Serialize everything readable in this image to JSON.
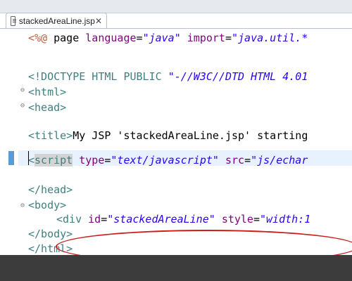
{
  "tab": {
    "label": "stackedAreaLine.jsp",
    "close": "✕",
    "icon": "jsp-file-icon"
  },
  "editor": {
    "lines": [
      {
        "segments": [
          [
            "jsp",
            "<%@ "
          ],
          [
            "text",
            "page "
          ],
          [
            "attr",
            "language"
          ],
          [
            "text",
            "="
          ],
          [
            "val",
            "\"java\""
          ],
          [
            "text",
            " "
          ],
          [
            "attr",
            "import"
          ],
          [
            "text",
            "="
          ],
          [
            "val",
            "\"java.util.*"
          ]
        ]
      },
      {
        "segments": [
          [
            "tag",
            "<!DOCTYPE HTML PUBLIC "
          ],
          [
            "val",
            "\"-//W3C//DTD HTML 4.01"
          ]
        ]
      },
      {
        "segments": [
          [
            "tag",
            "<html>"
          ]
        ]
      },
      {
        "segments": [
          [
            "tag",
            "<head>"
          ]
        ]
      },
      {
        "segments": [
          [
            "tag",
            "<title>"
          ],
          [
            "text",
            "My JSP 'stackedAreaLine.jsp' starting"
          ]
        ]
      },
      {
        "segments": [
          [
            "tag",
            "<script"
          ],
          [
            "text",
            " "
          ],
          [
            "attr",
            "type"
          ],
          [
            "text",
            "="
          ],
          [
            "val",
            "\"text/javascript\""
          ],
          [
            "text",
            " "
          ],
          [
            "attr",
            "src"
          ],
          [
            "text",
            "="
          ],
          [
            "val",
            "\"js/echar"
          ]
        ]
      },
      {
        "segments": [
          [
            "tag",
            "</head>"
          ]
        ]
      },
      {
        "segments": [
          [
            "tag",
            "<body>"
          ]
        ]
      },
      {
        "segments": [
          [
            "tag",
            "<div"
          ],
          [
            "text",
            " "
          ],
          [
            "attr",
            "id"
          ],
          [
            "text",
            "="
          ],
          [
            "val",
            "\"stackedAreaLine\""
          ],
          [
            "text",
            " "
          ],
          [
            "attr",
            "style"
          ],
          [
            "text",
            "="
          ],
          [
            "val",
            "\"width:1"
          ]
        ]
      },
      {
        "segments": [
          [
            "tag",
            "</body>"
          ]
        ]
      },
      {
        "segments": [
          [
            "tag",
            "</html>"
          ]
        ]
      }
    ],
    "folds": [
      "⊖",
      "⊖",
      "⊖"
    ]
  },
  "colors": {
    "tag": "#3f7f7f",
    "attr": "#7f007f",
    "value": "#2a00ff",
    "annotation": "#cc1d1d",
    "current_line": "#e8f2fe"
  }
}
